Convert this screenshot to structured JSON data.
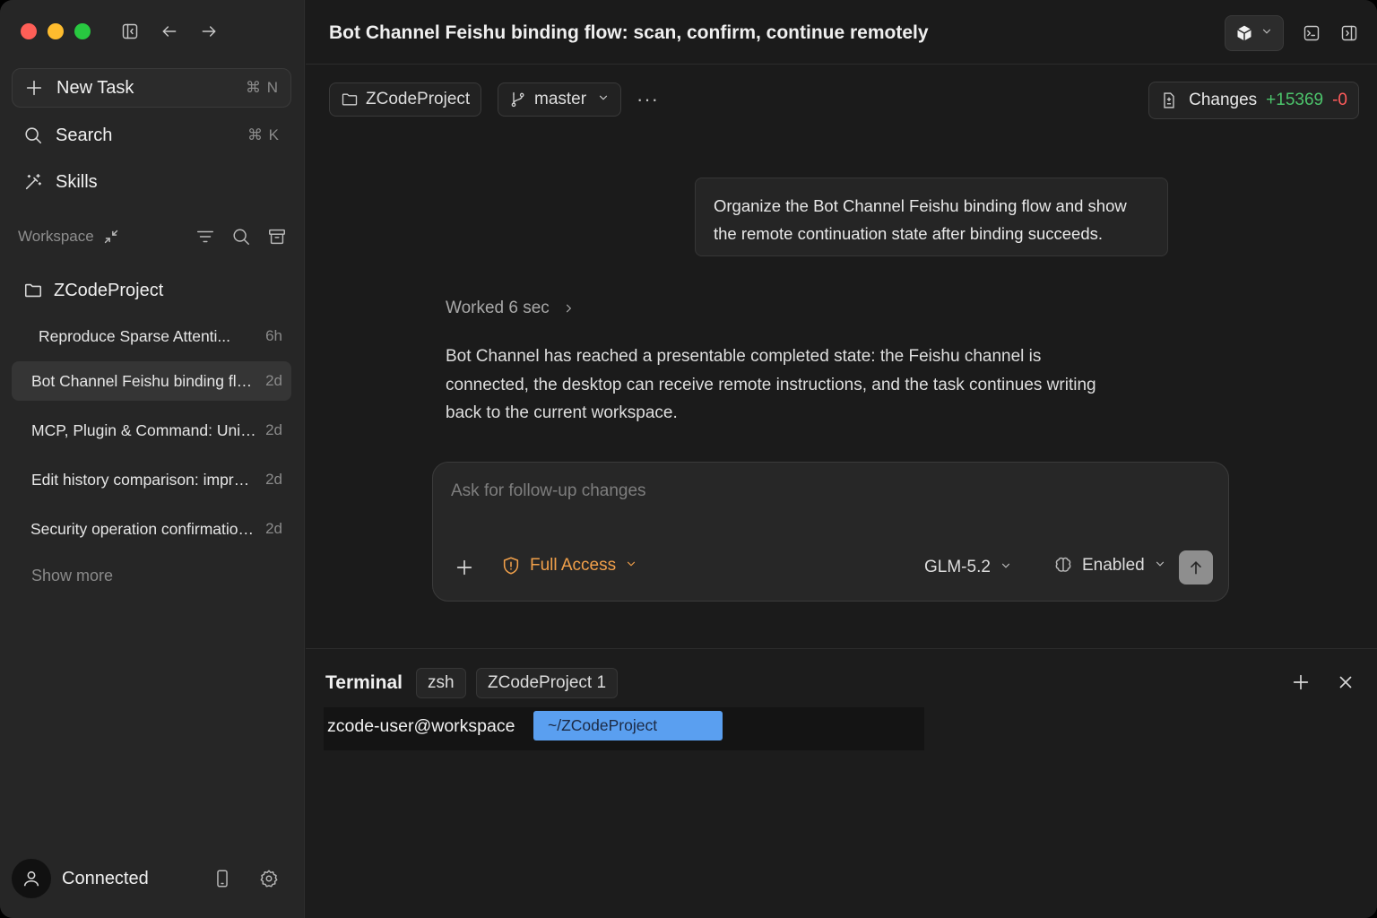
{
  "window": {
    "title": "Bot Channel Feishu binding flow: scan, confirm, continue remotely"
  },
  "sidebar": {
    "new_task": {
      "label": "New Task",
      "shortcut": "⌘ N"
    },
    "search": {
      "label": "Search",
      "shortcut": "⌘ K"
    },
    "skills": {
      "label": "Skills"
    },
    "workspace_label": "Workspace",
    "project": "ZCodeProject",
    "tasks": [
      {
        "title": "Reproduce Sparse Attenti...",
        "age": "6h",
        "active": false
      },
      {
        "title": "Bot Channel Feishu binding flow...",
        "age": "2d",
        "active": true
      },
      {
        "title": "MCP,  Plugin & Command: Unif...",
        "age": "2d",
        "active": false
      },
      {
        "title": "Edit history comparison: improv...",
        "age": "2d",
        "active": false
      },
      {
        "title": "Security operation confirmation...",
        "age": "2d",
        "active": false
      }
    ],
    "show_more": "Show more",
    "user_status": "Connected"
  },
  "toolbar": {
    "project_chip": "ZCodeProject",
    "branch": "master",
    "more": "···",
    "changes_label": "Changes",
    "additions": "+15369",
    "deletions": "-0"
  },
  "conversation": {
    "user_message": "Organize the Bot Channel Feishu binding flow and show the remote continuation state after binding succeeds.",
    "worked": "Worked 6 sec",
    "assistant_reply": "Bot Channel has reached a presentable completed state: the Feishu channel is connected, the desktop can receive remote instructions, and the task continues writing back to the current workspace."
  },
  "composer": {
    "placeholder": "Ask for follow-up changes",
    "access": "Full Access",
    "model": "GLM-5.2",
    "thinking": "Enabled"
  },
  "terminal": {
    "title": "Terminal",
    "tabs": [
      "zsh",
      "ZCodeProject 1"
    ],
    "prompt_user": "zcode-user@workspace",
    "prompt_path": "~/ZCodeProject"
  },
  "colors": {
    "accent_orange": "#f1a04a",
    "additions_green": "#4cc36b",
    "deletions_red": "#ff5b5b",
    "prompt_blue": "#5a9ff0"
  }
}
